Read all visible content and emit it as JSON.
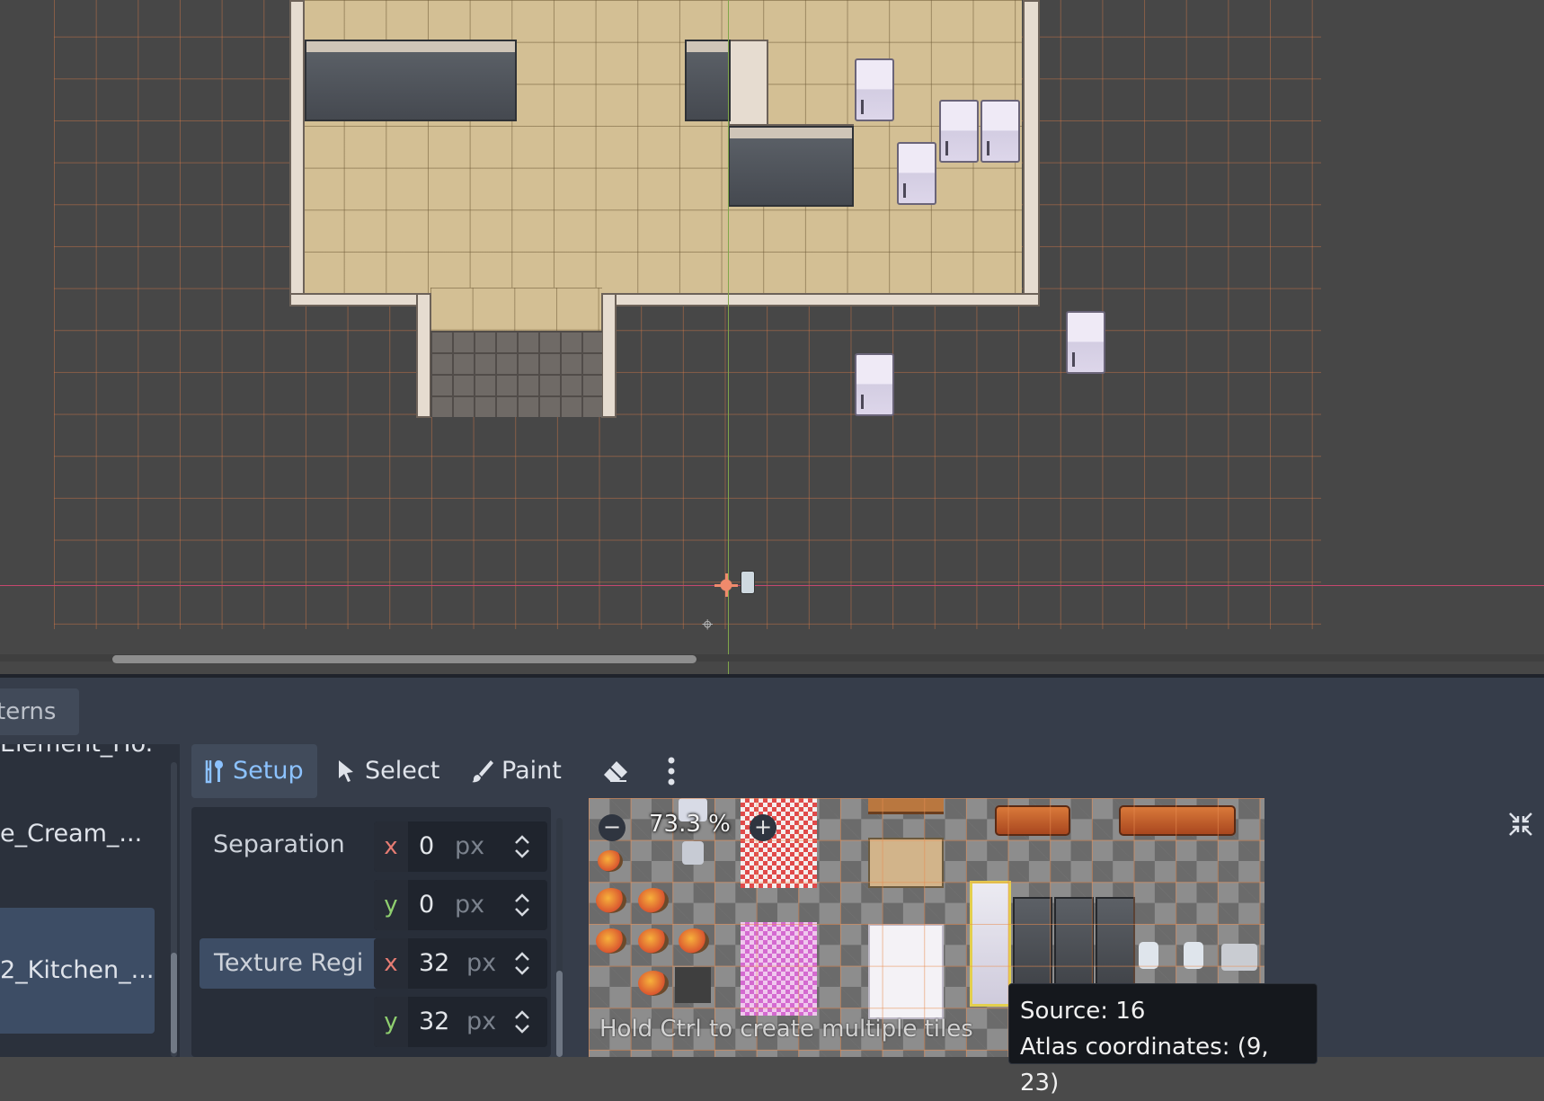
{
  "viewport": {
    "origin_icon": "crosshair-origin",
    "pivot_icon": "pivot-crosshair"
  },
  "panel": {
    "patterns_tab_label": "terns",
    "sources": [
      {
        "label": "Element_Ho..."
      },
      {
        "label": "e_Cream_..."
      },
      {
        "label": "2_Kitchen_...",
        "selected": true
      }
    ],
    "toolbar": {
      "setup_label": "Setup",
      "select_label": "Select",
      "paint_label": "Paint",
      "eraser_icon": "eraser-icon",
      "more_icon": "kebab-menu-icon"
    },
    "inspector": {
      "separation_label": "Separation",
      "separation_x": "0",
      "separation_y": "0",
      "texture_region_label": "Texture Regi",
      "texture_region_x": "32",
      "texture_region_y": "32",
      "unit": "px",
      "x_tag": "x",
      "y_tag": "y"
    },
    "atlas": {
      "zoom_label": "73.3 %",
      "zoom_out_icon": "minus-circle-icon",
      "zoom_in_icon": "plus-circle-icon",
      "hint": "Hold Ctrl to create multiple tiles",
      "tooltip_source": "Source: 16",
      "tooltip_atlas": "Atlas coordinates: (9, 23)"
    }
  },
  "colors": {
    "accent": "#8cc2ff",
    "selection": "#3d4d65",
    "grid_line": "#e07c48",
    "axis_x": "#c6476e",
    "axis_y": "#7fa64a"
  }
}
